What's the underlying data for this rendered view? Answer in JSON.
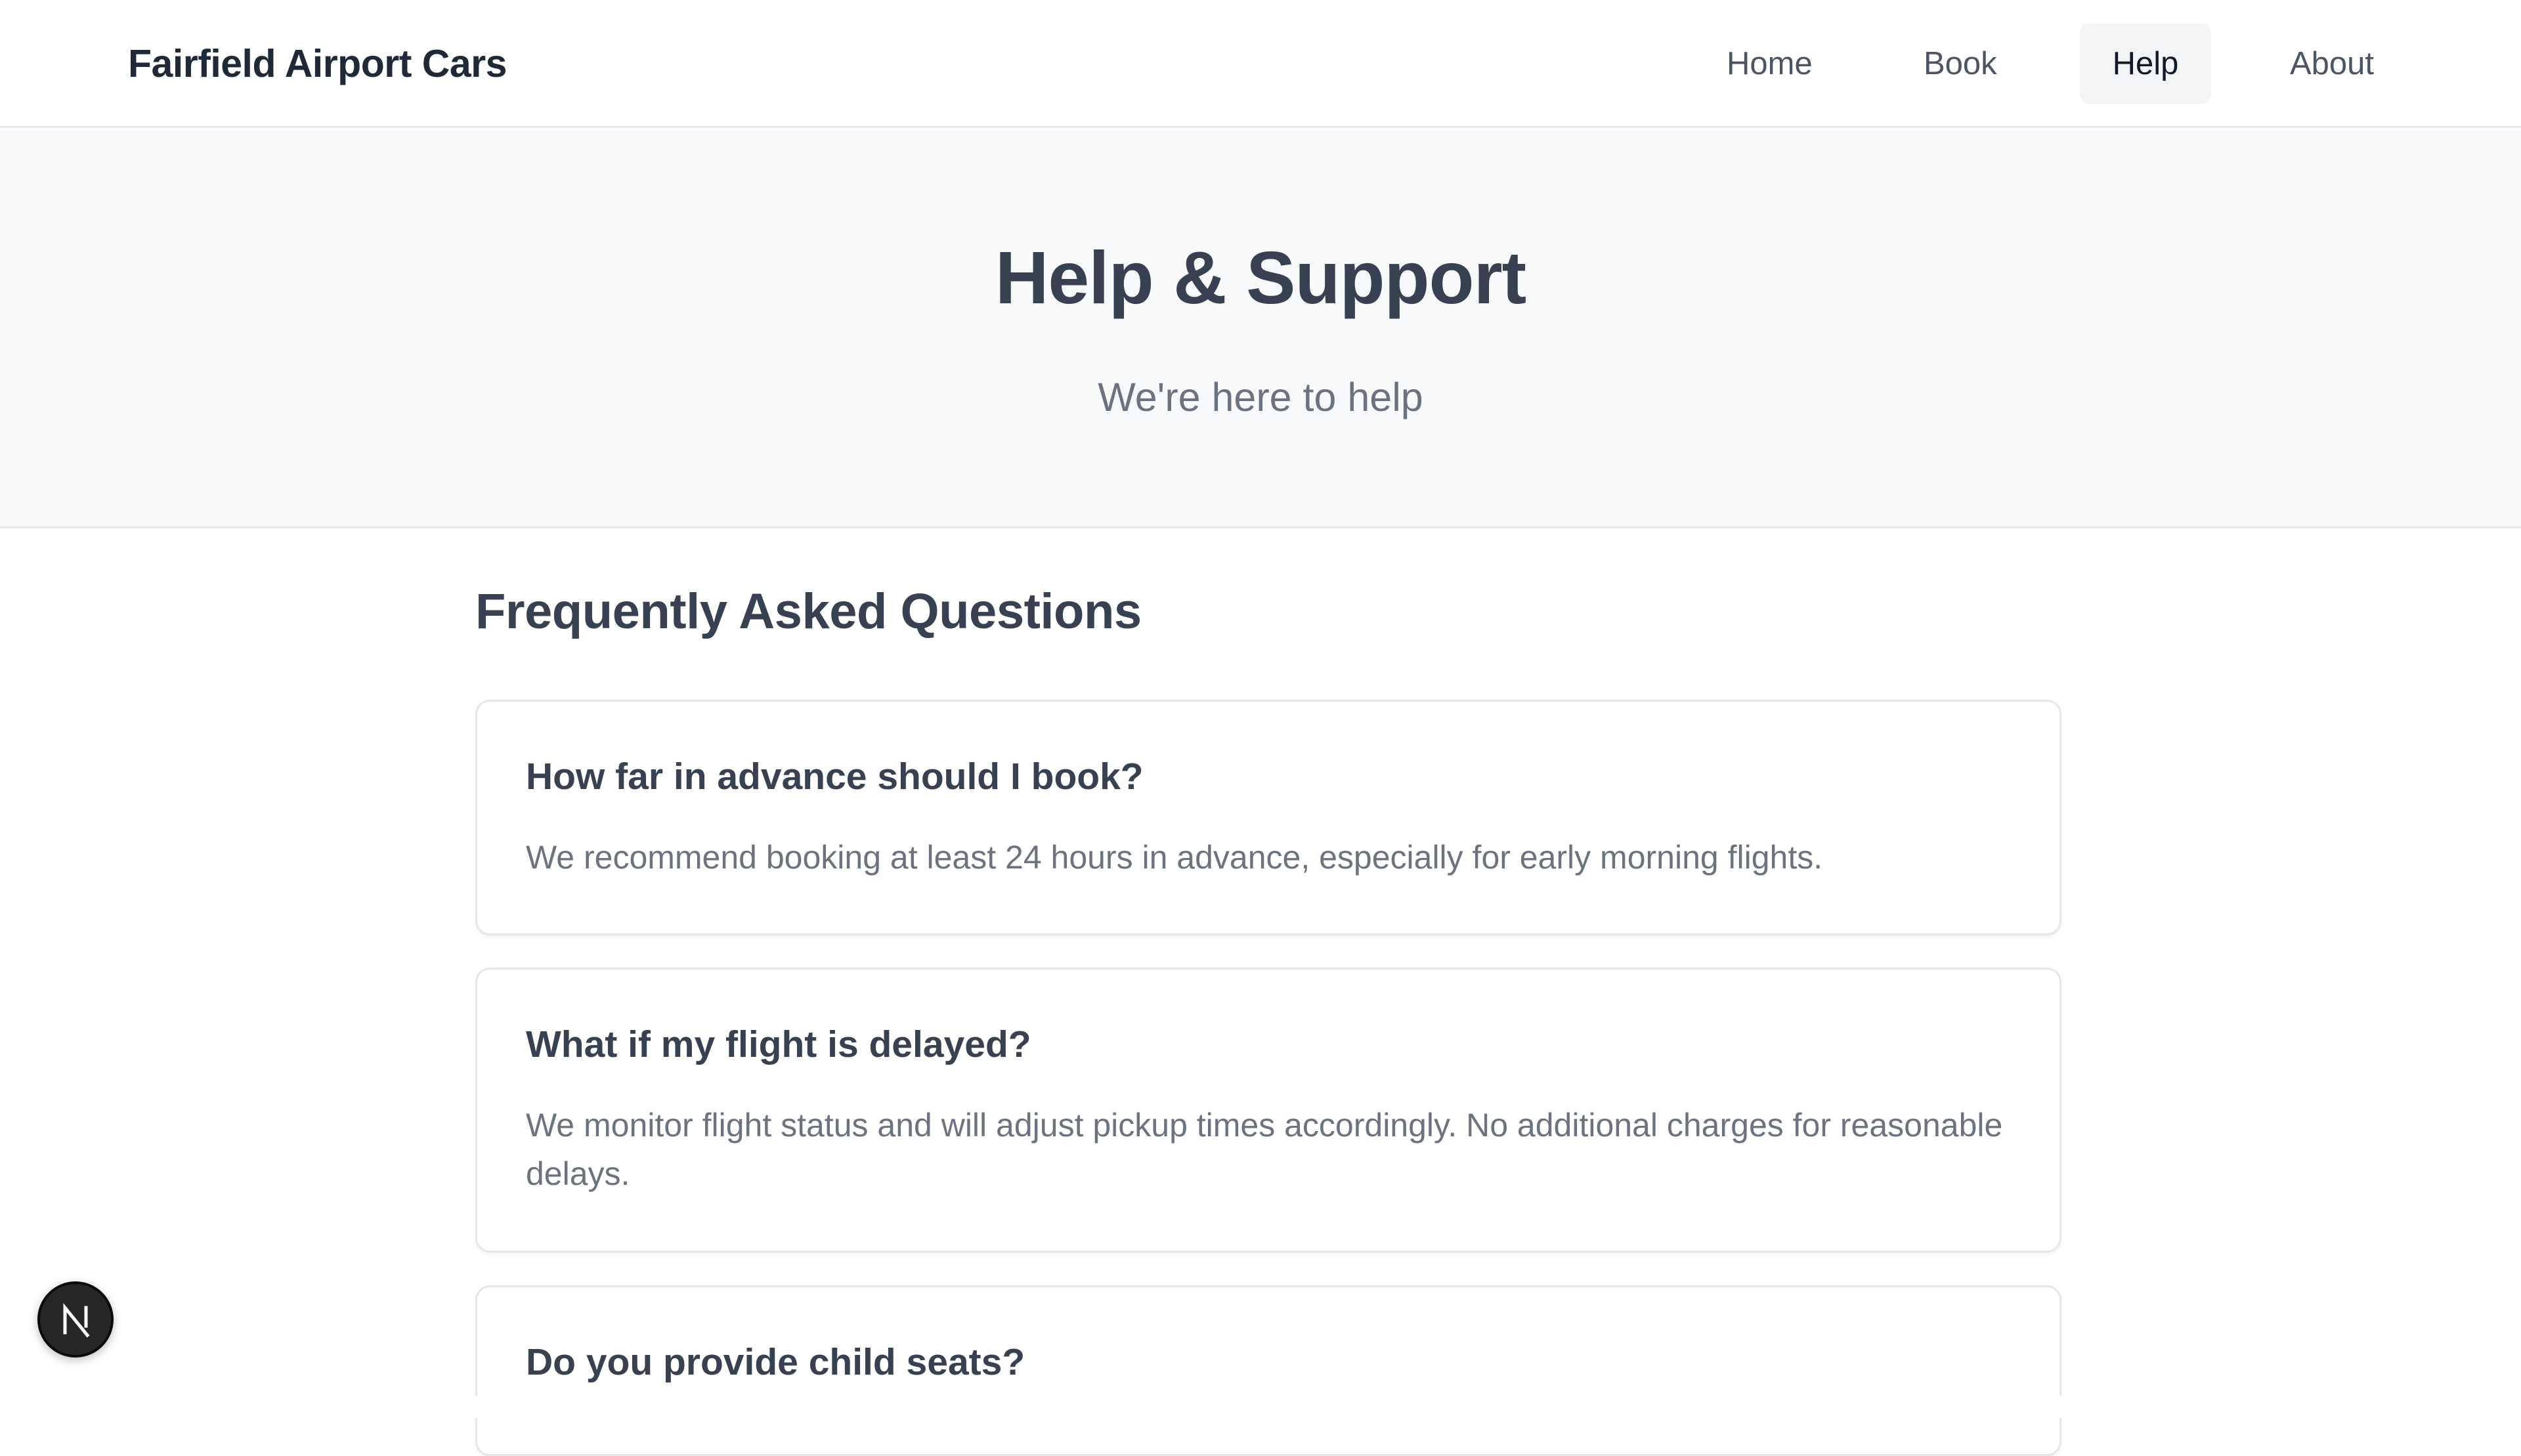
{
  "brand": "Fairfield Airport Cars",
  "nav": {
    "home": "Home",
    "book": "Book",
    "help": "Help",
    "about": "About",
    "active": "Help"
  },
  "hero": {
    "title": "Help & Support",
    "subtitle": "We're here to help"
  },
  "faq": {
    "heading": "Frequently Asked Questions",
    "items": [
      {
        "question": "How far in advance should I book?",
        "answer": "We recommend booking at least 24 hours in advance, especially for early morning flights."
      },
      {
        "question": "What if my flight is delayed?",
        "answer": "We monitor flight status and will adjust pickup times accordingly. No additional charges for reasonable delays."
      },
      {
        "question": "Do you provide child seats?",
        "answer": ""
      }
    ]
  },
  "badge": {
    "icon": "n-logo-icon",
    "letter": "N"
  },
  "colors": {
    "text": "#374151",
    "muted": "#6b7280",
    "hero_bg": "#f8f9fb",
    "border": "#e5e7eb",
    "active_nav_bg": "#f3f4f6"
  }
}
